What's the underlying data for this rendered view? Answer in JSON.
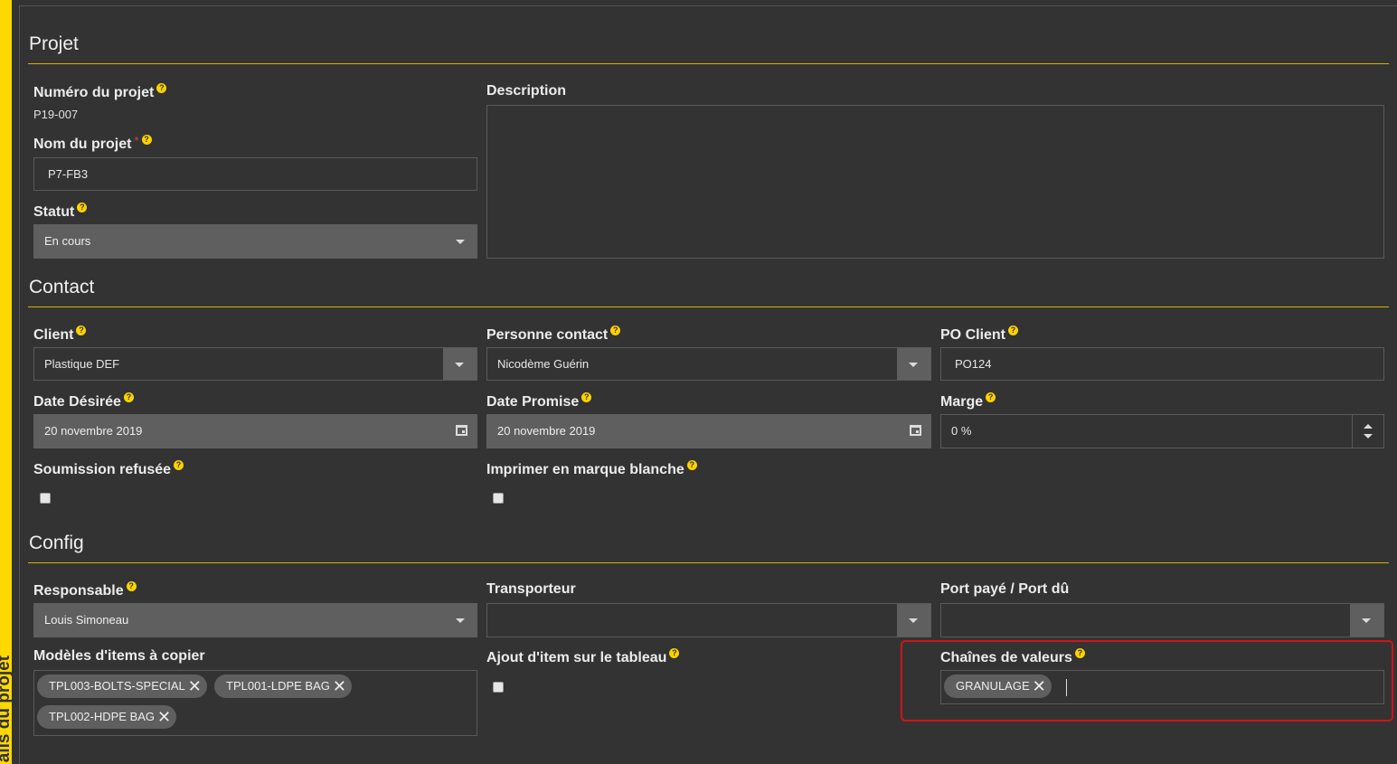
{
  "sidebar": {
    "tab_label": "ails du projet"
  },
  "colors": {
    "accent": "#ffd800",
    "section_rule": "#d4b300",
    "highlight": "#d0141a",
    "field_fill": "#5f5f5f",
    "background": "#333333"
  },
  "sections": {
    "projet": "Projet",
    "contact": "Contact",
    "config": "Config"
  },
  "help_icon_glyph": "?",
  "required_mark": "*",
  "projet": {
    "numero_label": "Numéro du projet",
    "numero_value": "P19-007",
    "nom_label": "Nom du projet",
    "nom_value": "P7-FB3",
    "statut_label": "Statut",
    "statut_value": "En cours",
    "description_label": "Description",
    "description_value": ""
  },
  "contact": {
    "client_label": "Client",
    "client_value": "Plastique DEF",
    "personne_label": "Personne contact",
    "personne_value": "Nicodème Guérin",
    "po_label": "PO Client",
    "po_value": "PO124",
    "date_desiree_label": "Date Désirée",
    "date_desiree_value": "20 novembre 2019",
    "date_promise_label": "Date Promise",
    "date_promise_value": "20 novembre 2019",
    "marge_label": "Marge",
    "marge_value": "0 %",
    "soumission_label": "Soumission refusée",
    "imprimer_label": "Imprimer en marque blanche"
  },
  "config": {
    "responsable_label": "Responsable",
    "responsable_value": "Louis Simoneau",
    "transporteur_label": "Transporteur",
    "transporteur_value": "",
    "port_label": "Port payé / Port dû",
    "port_value": "",
    "modeles_label": "Modèles d'items à copier",
    "modeles_tags": [
      "TPL003-BOLTS-SPECIAL",
      "TPL001-LDPE BAG",
      "TPL002-HDPE BAG"
    ],
    "ajout_label": "Ajout d'item sur le tableau",
    "chaines_label": "Chaînes de valeurs",
    "chaines_tags": [
      "GRANULAGE"
    ]
  },
  "icons": {
    "remove_tag": "close-icon",
    "dropdown": "chevron-down-icon",
    "calendar": "calendar-icon",
    "spinner": "spinner-arrows-icon",
    "help": "help-icon"
  }
}
